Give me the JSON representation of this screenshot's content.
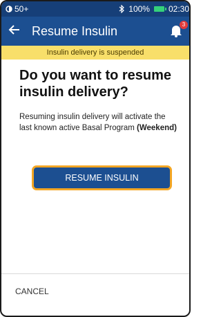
{
  "status_bar": {
    "signal": "50+",
    "bluetooth_icon": "bluetooth-icon",
    "battery": "100%",
    "time": "02:30"
  },
  "app_bar": {
    "title": "Resume Insulin",
    "notification_count": "3",
    "back_icon": "arrow-left-icon",
    "bell_icon": "bell-icon"
  },
  "banner": {
    "text": "Insulin delivery is suspended"
  },
  "main": {
    "question": "Do you want to resume insulin delivery?",
    "info_prefix": "Resuming insulin delivery will activate the last known active Basal Program ",
    "info_program": "(Weekend)"
  },
  "actions": {
    "resume_label": "RESUME INSULIN",
    "cancel_label": "CANCEL"
  },
  "colors": {
    "app_bar": "#1c4f91",
    "banner": "#f8df6a",
    "button_outline": "#f3a624",
    "battery": "#35d17a"
  }
}
